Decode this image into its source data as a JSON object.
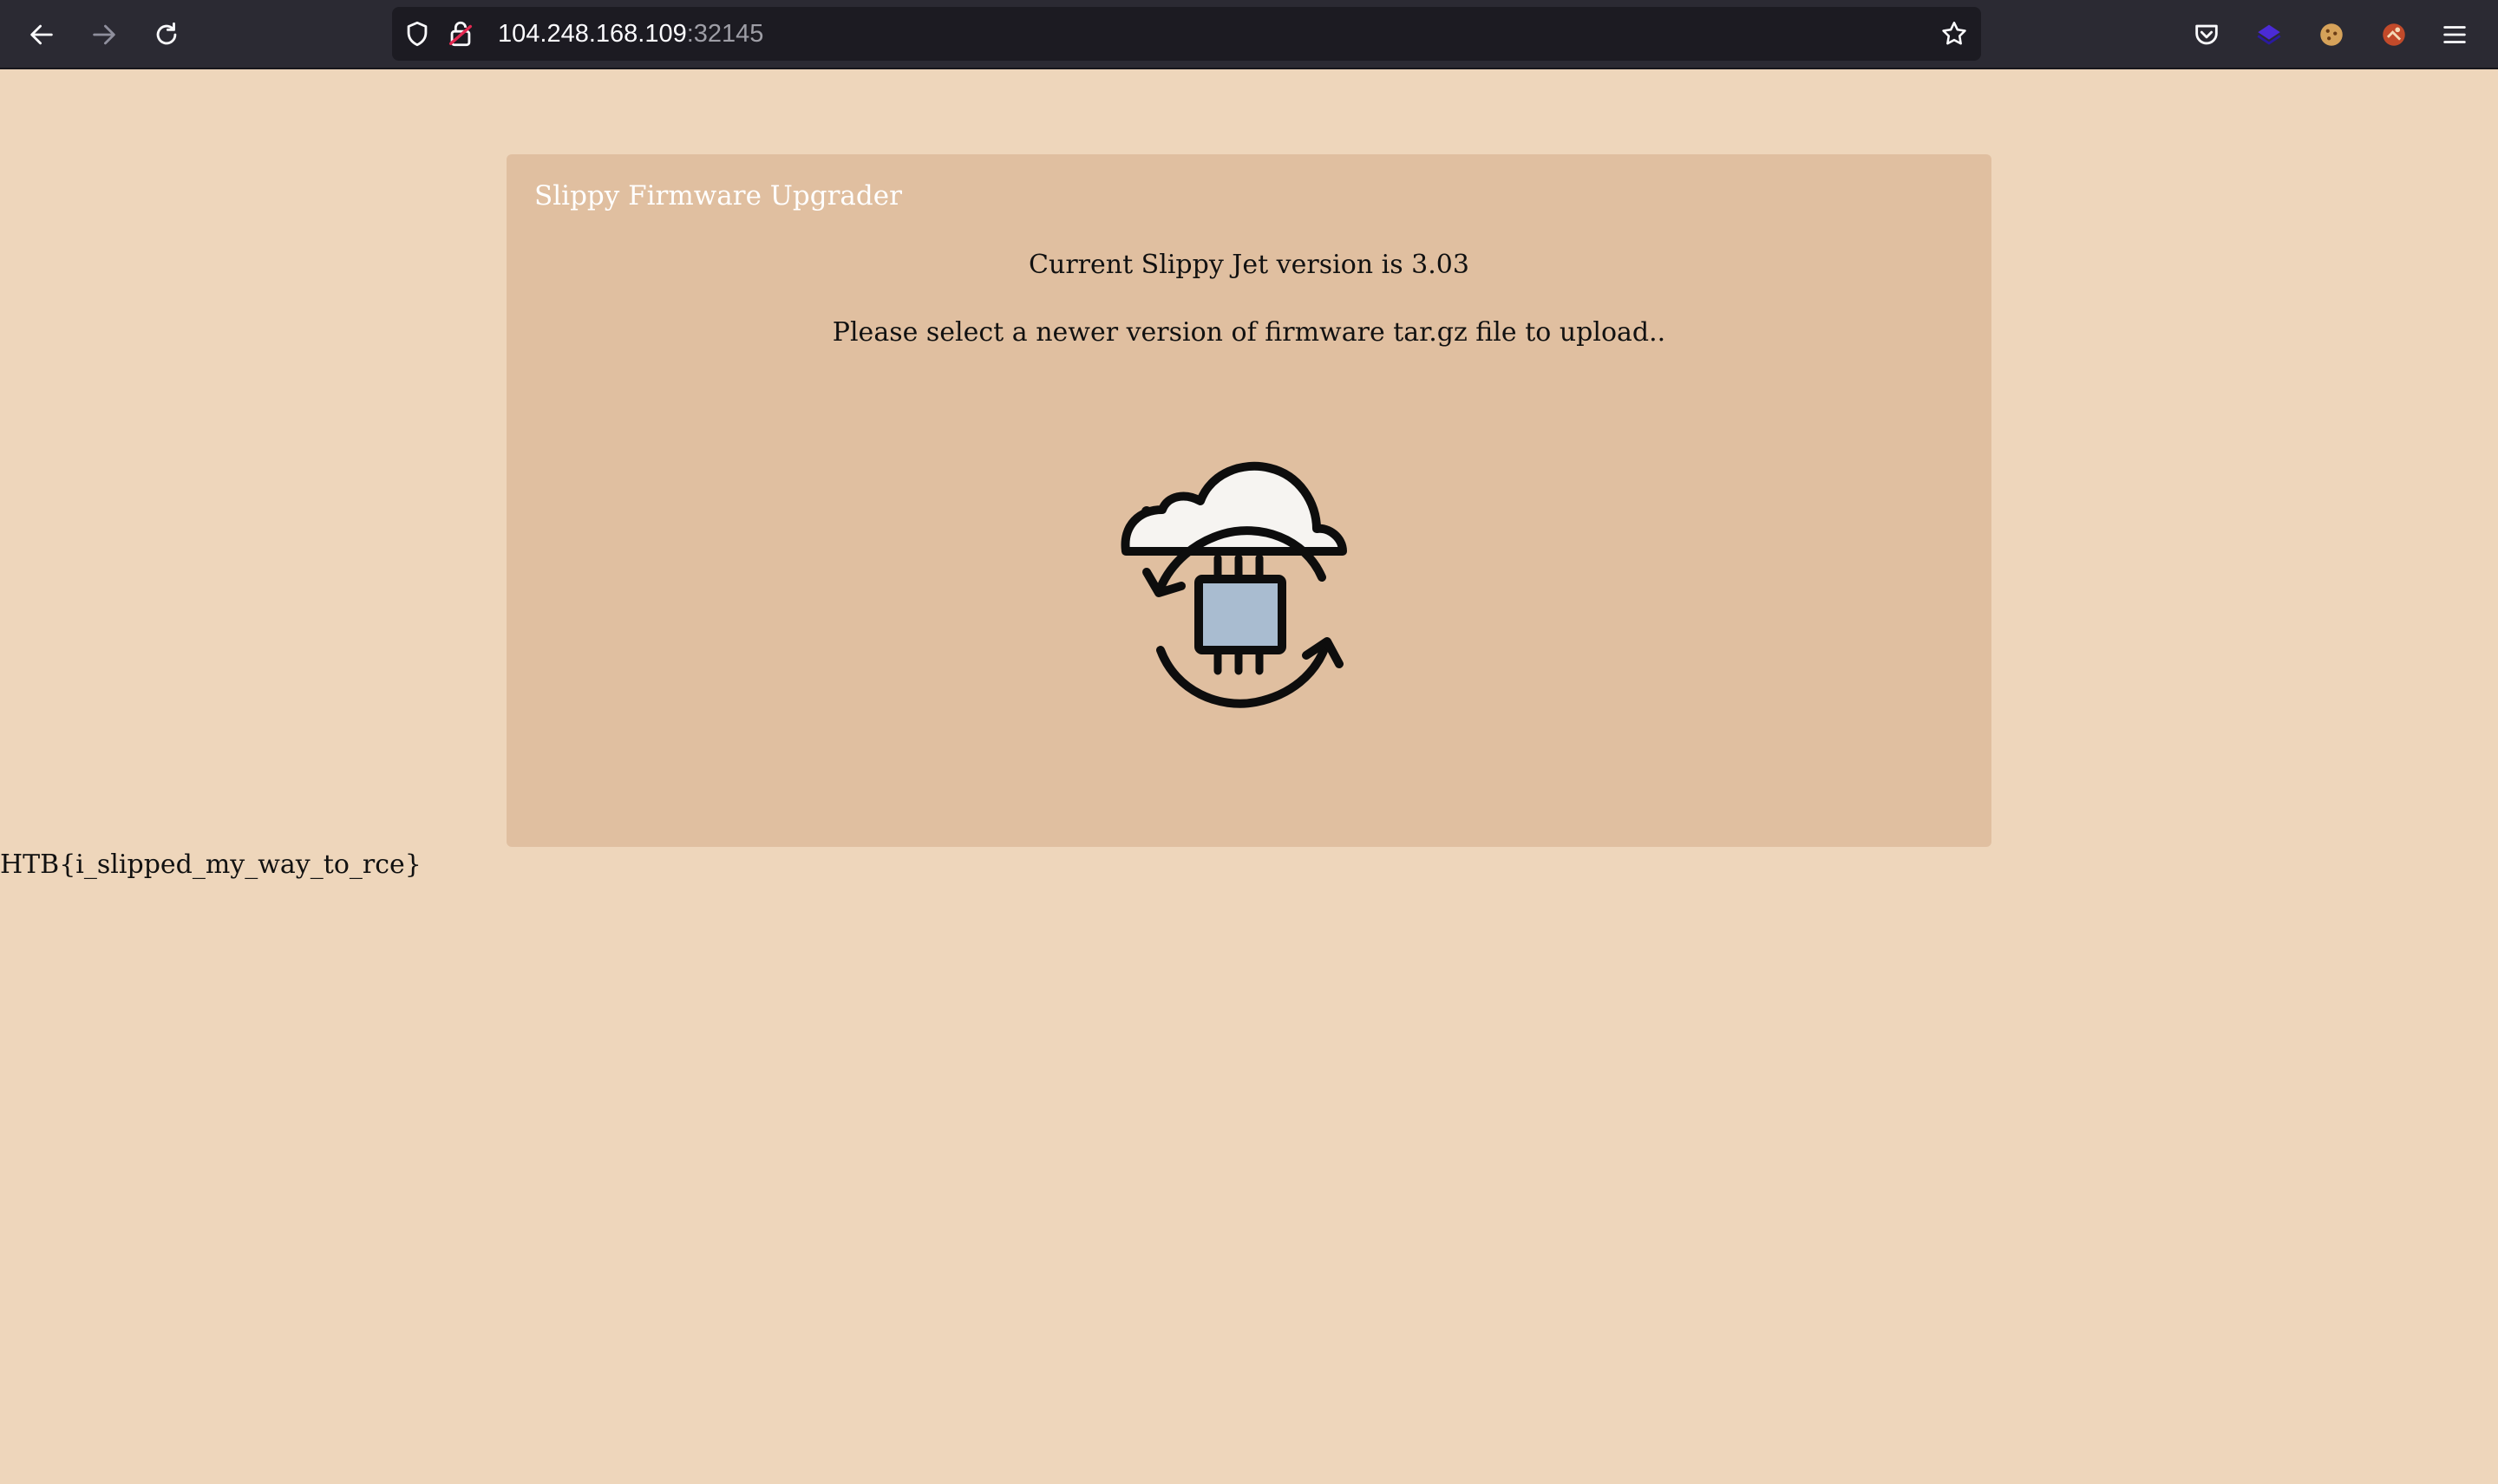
{
  "browser": {
    "url_host": "104.248.168.109",
    "url_port": ":32145",
    "icons": [
      "back-icon",
      "forward-icon",
      "reload-icon",
      "shield-icon",
      "insecure-lock-icon",
      "bookmark-star-icon",
      "pocket-icon",
      "extension-icon",
      "cookie-icon",
      "extension-icon",
      "menu-icon"
    ]
  },
  "page": {
    "card_title": "Slippy Firmware Upgrader",
    "version_text": "Current Slippy Jet version is 3.03",
    "instruction_text": "Please select a newer version of firmware tar.gz file to upload..",
    "illustration": "cloud-firmware-update-icon",
    "output_text": "HTB{i_slipped_my_way_to_rce}"
  },
  "colors": {
    "page_bg": "#eed6bb",
    "card_bg": "#e0bfa0",
    "chrome_bg": "#2b2a33",
    "chip_fill": "#a9bcd0"
  }
}
